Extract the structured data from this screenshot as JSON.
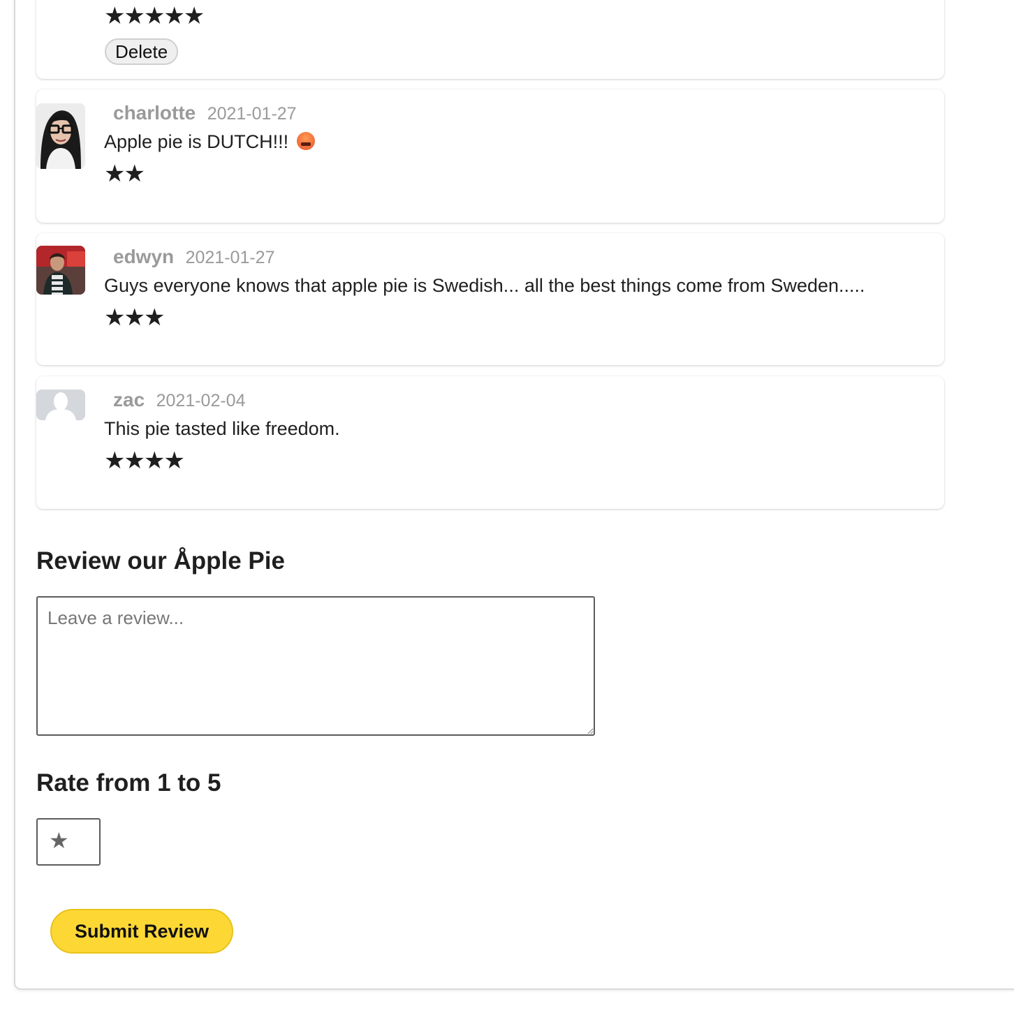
{
  "previous_review": {
    "stars": "★★★★★",
    "delete_label": "Delete"
  },
  "reviews": [
    {
      "username": "charlotte",
      "date": "2021-01-27",
      "text": "Apple pie is DUTCH!!!",
      "emoji": "face-with-symbols-on-mouth-icon",
      "stars": "★★",
      "rating": 2,
      "avatar": "avatar-photo"
    },
    {
      "username": "edwyn",
      "date": "2021-01-27",
      "text": "Guys everyone knows that apple pie is Swedish... all the best things come from Sweden.....",
      "stars": "★★★",
      "rating": 3,
      "avatar": "avatar-photo"
    },
    {
      "username": "zac",
      "date": "2021-02-04",
      "text": "This pie tasted like freedom.",
      "stars": "★★★★",
      "rating": 4,
      "avatar": "default-user-icon"
    }
  ],
  "form": {
    "heading": "Review our Åpple Pie",
    "textarea_placeholder": "Leave a review...",
    "rating_heading": "Rate from 1 to 5",
    "rating_value": "★",
    "submit_label": "Submit Review"
  },
  "colors": {
    "accent": "#fdd835",
    "muted_text": "#9a9a9a",
    "body_text": "#1f1f1f"
  }
}
